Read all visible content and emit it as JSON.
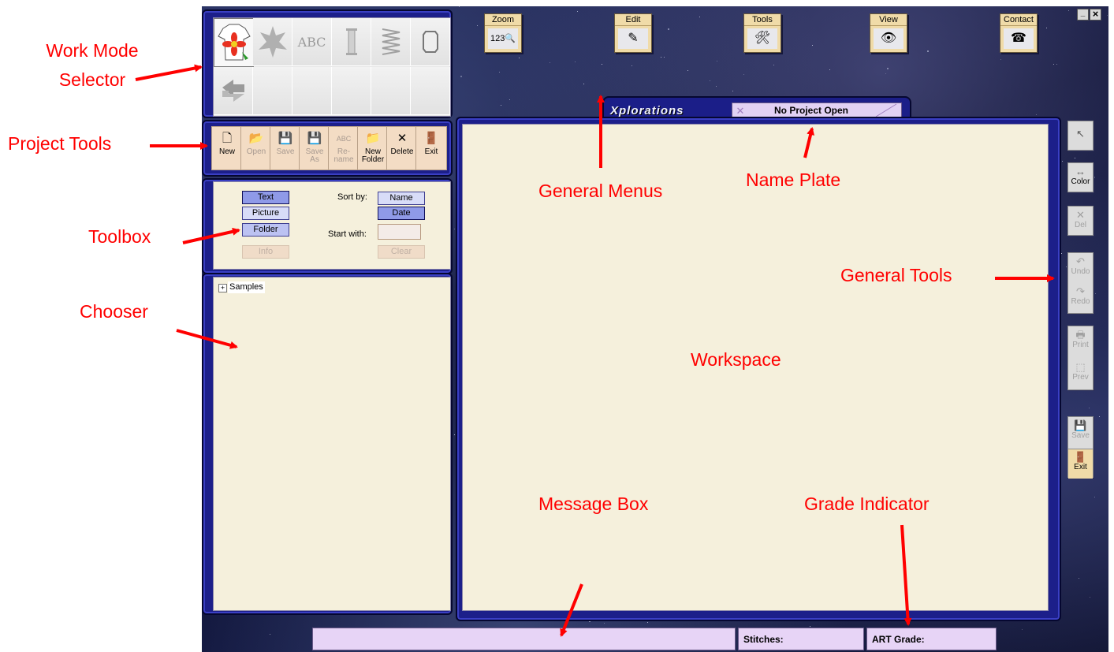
{
  "work_mode_selector": {
    "icons": [
      "tshirt-flower-icon",
      "leaf-icon",
      "abc-text-icon",
      "column-icon",
      "spring-icon",
      "frame-icon",
      "recycle-icon"
    ],
    "abc_label": "ABC"
  },
  "project_tools": [
    {
      "name": "new",
      "label": "New",
      "icon": "🗋",
      "enabled": true
    },
    {
      "name": "open",
      "label": "Open",
      "icon": "📂",
      "enabled": false
    },
    {
      "name": "save",
      "label": "Save",
      "icon": "💾",
      "enabled": false
    },
    {
      "name": "save-as",
      "label": "Save\nAs",
      "icon": "💾",
      "enabled": false
    },
    {
      "name": "rename",
      "label": "Re-\nname",
      "icon": "ABC",
      "enabled": false
    },
    {
      "name": "new-folder",
      "label": "New\nFolder",
      "icon": "📁",
      "enabled": true
    },
    {
      "name": "delete",
      "label": "Delete",
      "icon": "✕",
      "enabled": true
    },
    {
      "name": "exit",
      "label": "Exit",
      "icon": "🚪",
      "enabled": true
    }
  ],
  "toolbox": {
    "text": "Text",
    "picture": "Picture",
    "folder": "Folder",
    "info": "Info",
    "sort_by": "Sort by:",
    "name": "Name",
    "date": "Date",
    "start_with": "Start with:",
    "start_with_value": "",
    "clear": "Clear"
  },
  "chooser": {
    "tree": [
      {
        "label": "Samples",
        "expander": "+"
      }
    ]
  },
  "menus": [
    {
      "name": "zoom",
      "label": "Zoom",
      "icon": "123🔍"
    },
    {
      "name": "edit",
      "label": "Edit",
      "icon": "✎"
    },
    {
      "name": "tools",
      "label": "Tools",
      "icon": "🛠"
    },
    {
      "name": "view",
      "label": "View",
      "icon": "👁"
    },
    {
      "name": "contact",
      "label": "Contact",
      "icon": "☎"
    }
  ],
  "name_plate": {
    "brand": "Xplorations",
    "project": "No Project Open"
  },
  "general_tools": {
    "color": "Color",
    "del": "Del",
    "undo": "Undo",
    "redo": "Redo",
    "print": "Print",
    "prev": "Prev",
    "save": "Save",
    "exit": "Exit"
  },
  "status_bar": {
    "message": "",
    "stitches": "Stitches:",
    "art_grade": "ART Grade:"
  },
  "annotations": {
    "work_mode_selector": "Work Mode\nSelector",
    "project_tools": "Project Tools",
    "toolbox": "Toolbox",
    "chooser": "Chooser",
    "general_menus": "General Menus",
    "name_plate": "Name Plate",
    "general_tools": "General Tools",
    "workspace": "Workspace",
    "message_box": "Message Box",
    "grade_indicator": "Grade Indicator"
  },
  "window_controls": {
    "minimize": "_",
    "close": "×"
  },
  "colors": {
    "annotation": "#ff0000",
    "panel_frame": "#1c1f8a",
    "workspace_bg": "#f5f0dc",
    "status_box": "#e7d4f6",
    "button_tan": "#f3dcc4",
    "toolbox_blue": "#bcc2f2"
  }
}
